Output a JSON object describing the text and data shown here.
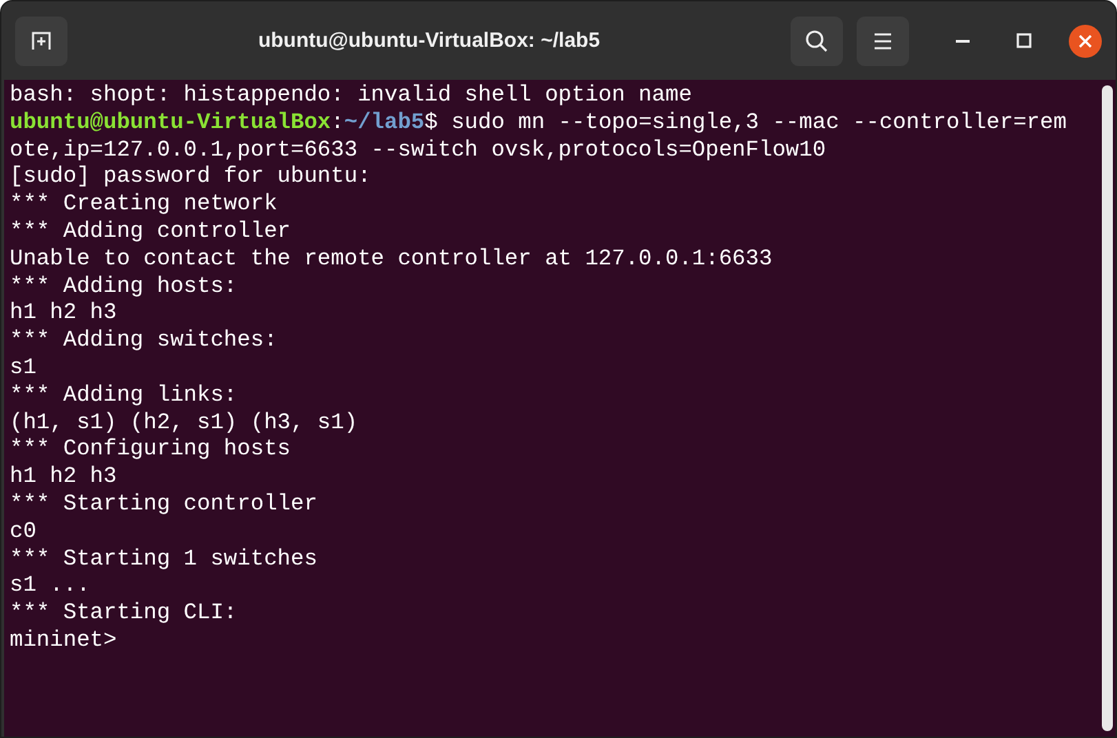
{
  "window": {
    "title": "ubuntu@ubuntu-VirtualBox: ~/lab5"
  },
  "terminal": {
    "lines": [
      {
        "kind": "output",
        "text": "bash: shopt: histappendo: invalid shell option name"
      },
      {
        "kind": "prompt",
        "user": "ubuntu@ubuntu-VirtualBox",
        "separator": ":",
        "path": "~/lab5",
        "command": "$ sudo mn --topo=single,3 --mac --controller=remote,ip=127.0.0.1,port=6633 --switch ovsk,protocols=OpenFlow10"
      },
      {
        "kind": "output",
        "text": "[sudo] password for ubuntu:"
      },
      {
        "kind": "output",
        "text": "*** Creating network"
      },
      {
        "kind": "output",
        "text": "*** Adding controller"
      },
      {
        "kind": "output",
        "text": "Unable to contact the remote controller at 127.0.0.1:6633"
      },
      {
        "kind": "output",
        "text": "*** Adding hosts:"
      },
      {
        "kind": "output",
        "text": "h1 h2 h3"
      },
      {
        "kind": "output",
        "text": "*** Adding switches:"
      },
      {
        "kind": "output",
        "text": "s1"
      },
      {
        "kind": "output",
        "text": "*** Adding links:"
      },
      {
        "kind": "output",
        "text": "(h1, s1) (h2, s1) (h3, s1)"
      },
      {
        "kind": "output",
        "text": "*** Configuring hosts"
      },
      {
        "kind": "output",
        "text": "h1 h2 h3"
      },
      {
        "kind": "output",
        "text": "*** Starting controller"
      },
      {
        "kind": "output",
        "text": "c0"
      },
      {
        "kind": "output",
        "text": "*** Starting 1 switches"
      },
      {
        "kind": "output",
        "text": "s1 ..."
      },
      {
        "kind": "output",
        "text": "*** Starting CLI:"
      },
      {
        "kind": "output",
        "text": "mininet>"
      }
    ]
  }
}
